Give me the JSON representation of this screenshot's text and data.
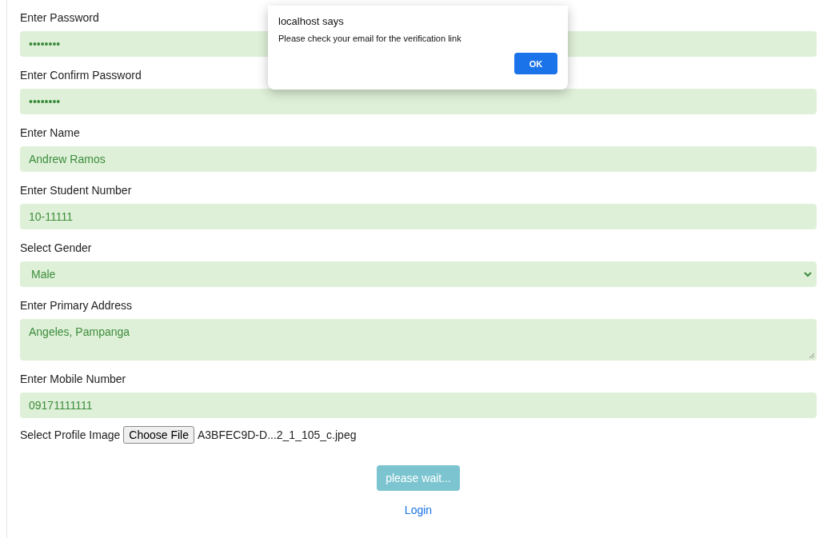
{
  "form": {
    "fields": [
      {
        "kind": "password",
        "label": "Enter Password",
        "value": "••••••••"
      },
      {
        "kind": "password",
        "label": "Enter Confirm Password",
        "value": "••••••••"
      },
      {
        "kind": "text",
        "label": "Enter Name",
        "value": "Andrew Ramos"
      },
      {
        "kind": "text",
        "label": "Enter Student Number",
        "value": "10-11111"
      },
      {
        "kind": "select",
        "label": "Select Gender",
        "value": "Male"
      },
      {
        "kind": "textarea",
        "label": "Enter Primary Address",
        "value": "Angeles, Pampanga"
      },
      {
        "kind": "text",
        "label": "Enter Mobile Number",
        "value": "09171111111"
      }
    ],
    "file": {
      "label": "Select Profile Image",
      "button": "Choose File",
      "filename": "A3BFEC9D-D...2_1_105_c.jpeg"
    },
    "submit": {
      "label": "please wait...",
      "disabled": true
    },
    "link": "Login"
  },
  "dialog": {
    "title": "localhost says",
    "message": "Please check your email for the verification link",
    "button": "OK"
  }
}
